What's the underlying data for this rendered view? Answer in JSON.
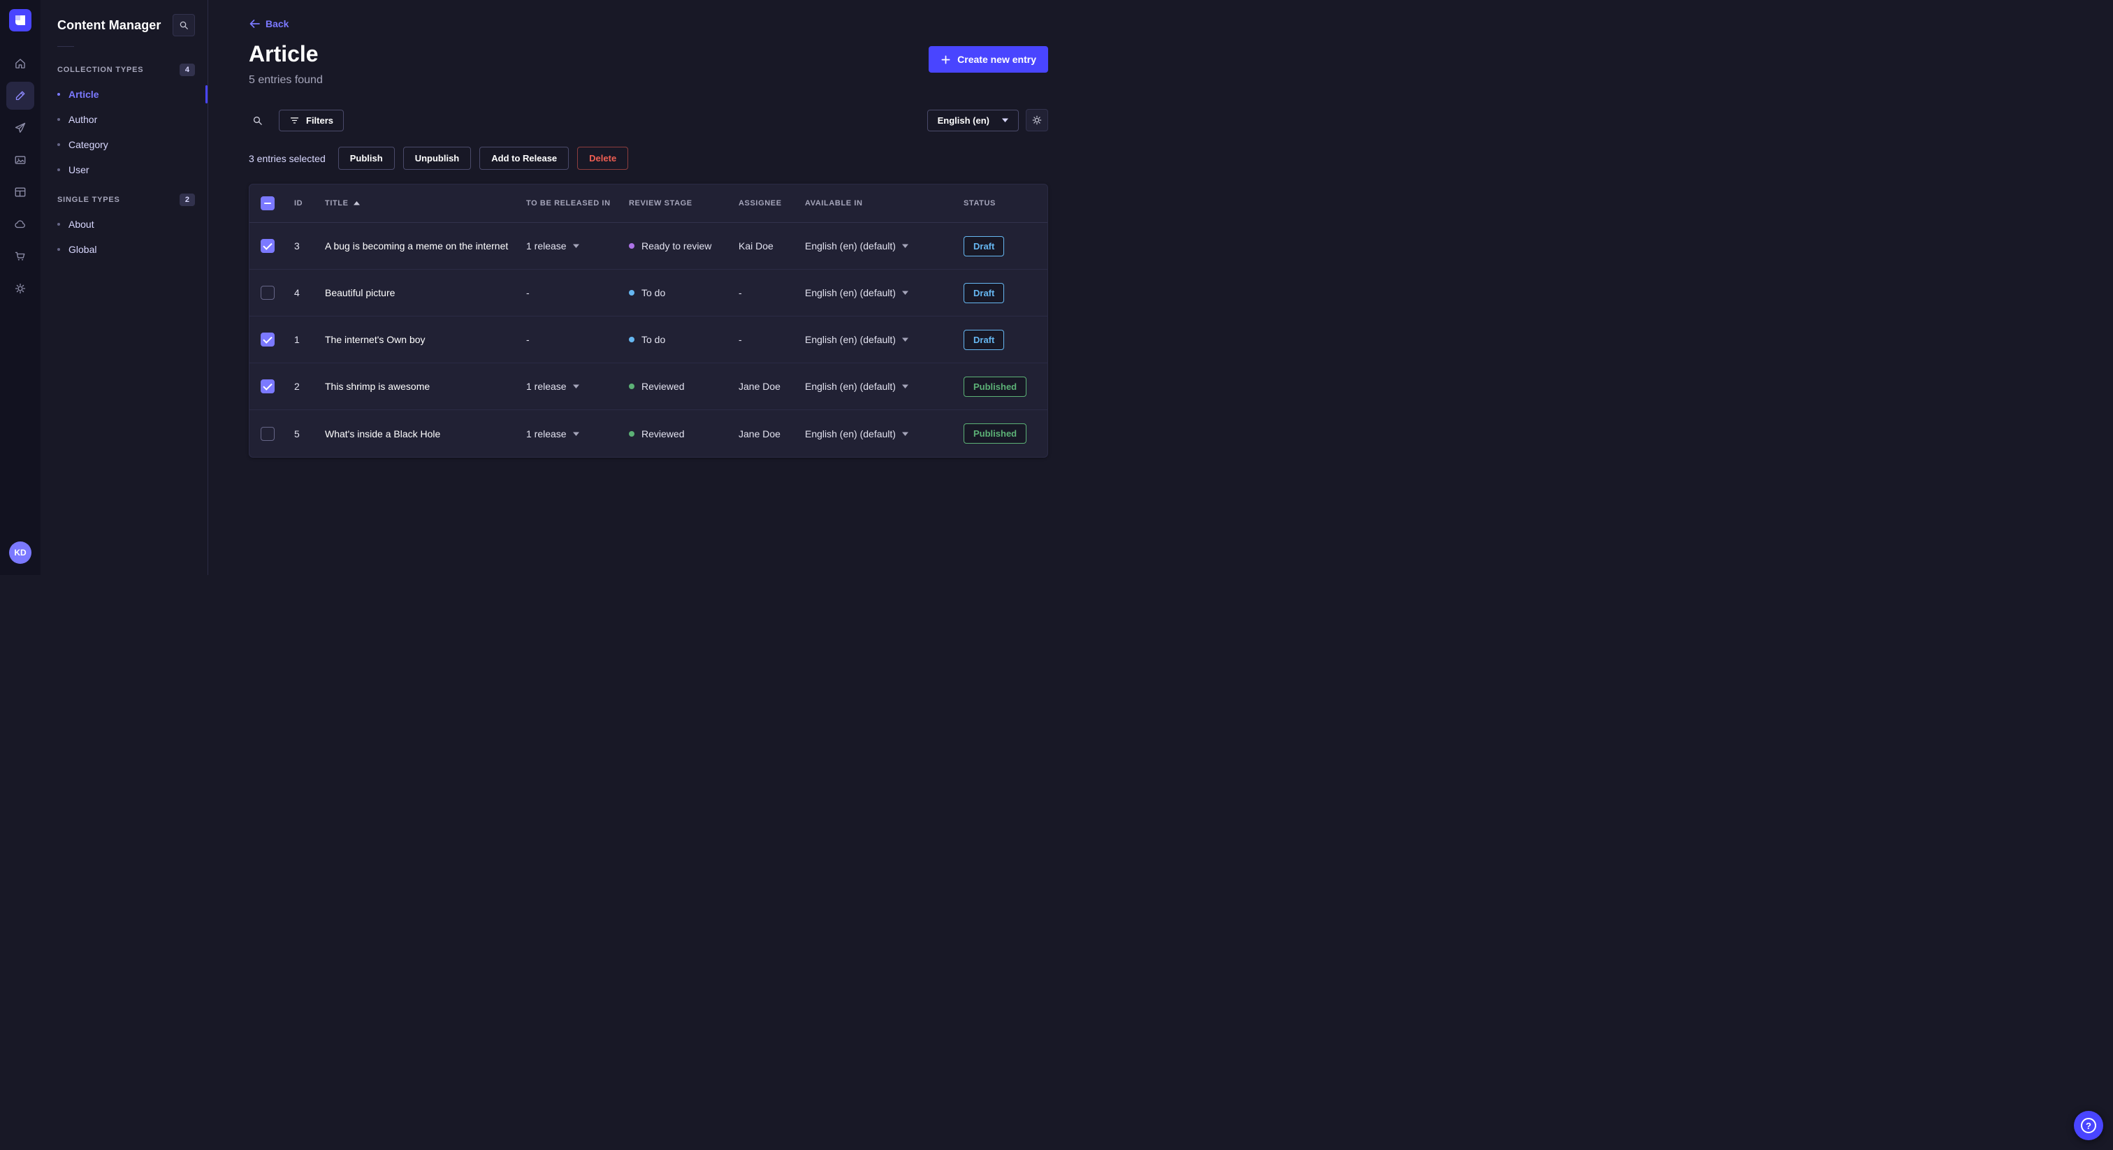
{
  "colors": {
    "primary": "#4945ff",
    "primary_light": "#7b79ff",
    "danger": "#ee5e52",
    "draft": "#66b7f1",
    "published": "#5cb176",
    "stage_purple": "#ac73e6",
    "stage_blue": "#66b7f1",
    "stage_green": "#5cb176"
  },
  "rail": {
    "avatar_initials": "KD"
  },
  "subnav": {
    "title": "Content Manager",
    "sections": [
      {
        "label": "COLLECTION TYPES",
        "badge": "4",
        "items": [
          {
            "label": "Article",
            "active": true
          },
          {
            "label": "Author"
          },
          {
            "label": "Category"
          },
          {
            "label": "User"
          }
        ]
      },
      {
        "label": "SINGLE TYPES",
        "badge": "2",
        "items": [
          {
            "label": "About"
          },
          {
            "label": "Global"
          }
        ]
      }
    ]
  },
  "header": {
    "back_label": "Back",
    "title": "Article",
    "subtitle": "5 entries found",
    "create_button_label": "Create new entry"
  },
  "toolbar": {
    "filters_label": "Filters",
    "locale_value": "English (en)"
  },
  "selection": {
    "count_label": "3 entries selected",
    "publish_label": "Publish",
    "unpublish_label": "Unpublish",
    "add_to_release_label": "Add to Release",
    "delete_label": "Delete"
  },
  "table": {
    "select_all_state": "indeterminate",
    "columns": {
      "id": "ID",
      "title": "TITLE",
      "release": "TO BE RELEASED IN",
      "review_stage": "REVIEW STAGE",
      "assignee": "ASSIGNEE",
      "available_in": "AVAILABLE IN",
      "status": "STATUS"
    },
    "rows": [
      {
        "checked": true,
        "id": "3",
        "title": "A bug is becoming a meme on the internet",
        "release": "1 release",
        "release_caret": true,
        "review_stage": "Ready to review",
        "stage_color": "#ac73e6",
        "assignee": "Kai Doe",
        "available_in": "English (en) (default)",
        "status": "Draft",
        "status_color": "#66b7f1"
      },
      {
        "checked": false,
        "id": "4",
        "title": "Beautiful picture",
        "release": "-",
        "release_caret": false,
        "review_stage": "To do",
        "stage_color": "#66b7f1",
        "assignee": "-",
        "available_in": "English (en) (default)",
        "status": "Draft",
        "status_color": "#66b7f1"
      },
      {
        "checked": true,
        "id": "1",
        "title": "The internet's Own boy",
        "release": "-",
        "release_caret": false,
        "review_stage": "To do",
        "stage_color": "#66b7f1",
        "assignee": "-",
        "available_in": "English (en) (default)",
        "status": "Draft",
        "status_color": "#66b7f1"
      },
      {
        "checked": true,
        "id": "2",
        "title": "This shrimp is awesome",
        "release": "1 release",
        "release_caret": true,
        "review_stage": "Reviewed",
        "stage_color": "#5cb176",
        "assignee": "Jane Doe",
        "available_in": "English (en) (default)",
        "status": "Published",
        "status_color": "#5cb176"
      },
      {
        "checked": false,
        "id": "5",
        "title": "What's inside a Black Hole",
        "release": "1 release",
        "release_caret": true,
        "review_stage": "Reviewed",
        "stage_color": "#5cb176",
        "assignee": "Jane Doe",
        "available_in": "English (en) (default)",
        "status": "Published",
        "status_color": "#5cb176"
      }
    ]
  },
  "help": {
    "glyph": "?"
  }
}
